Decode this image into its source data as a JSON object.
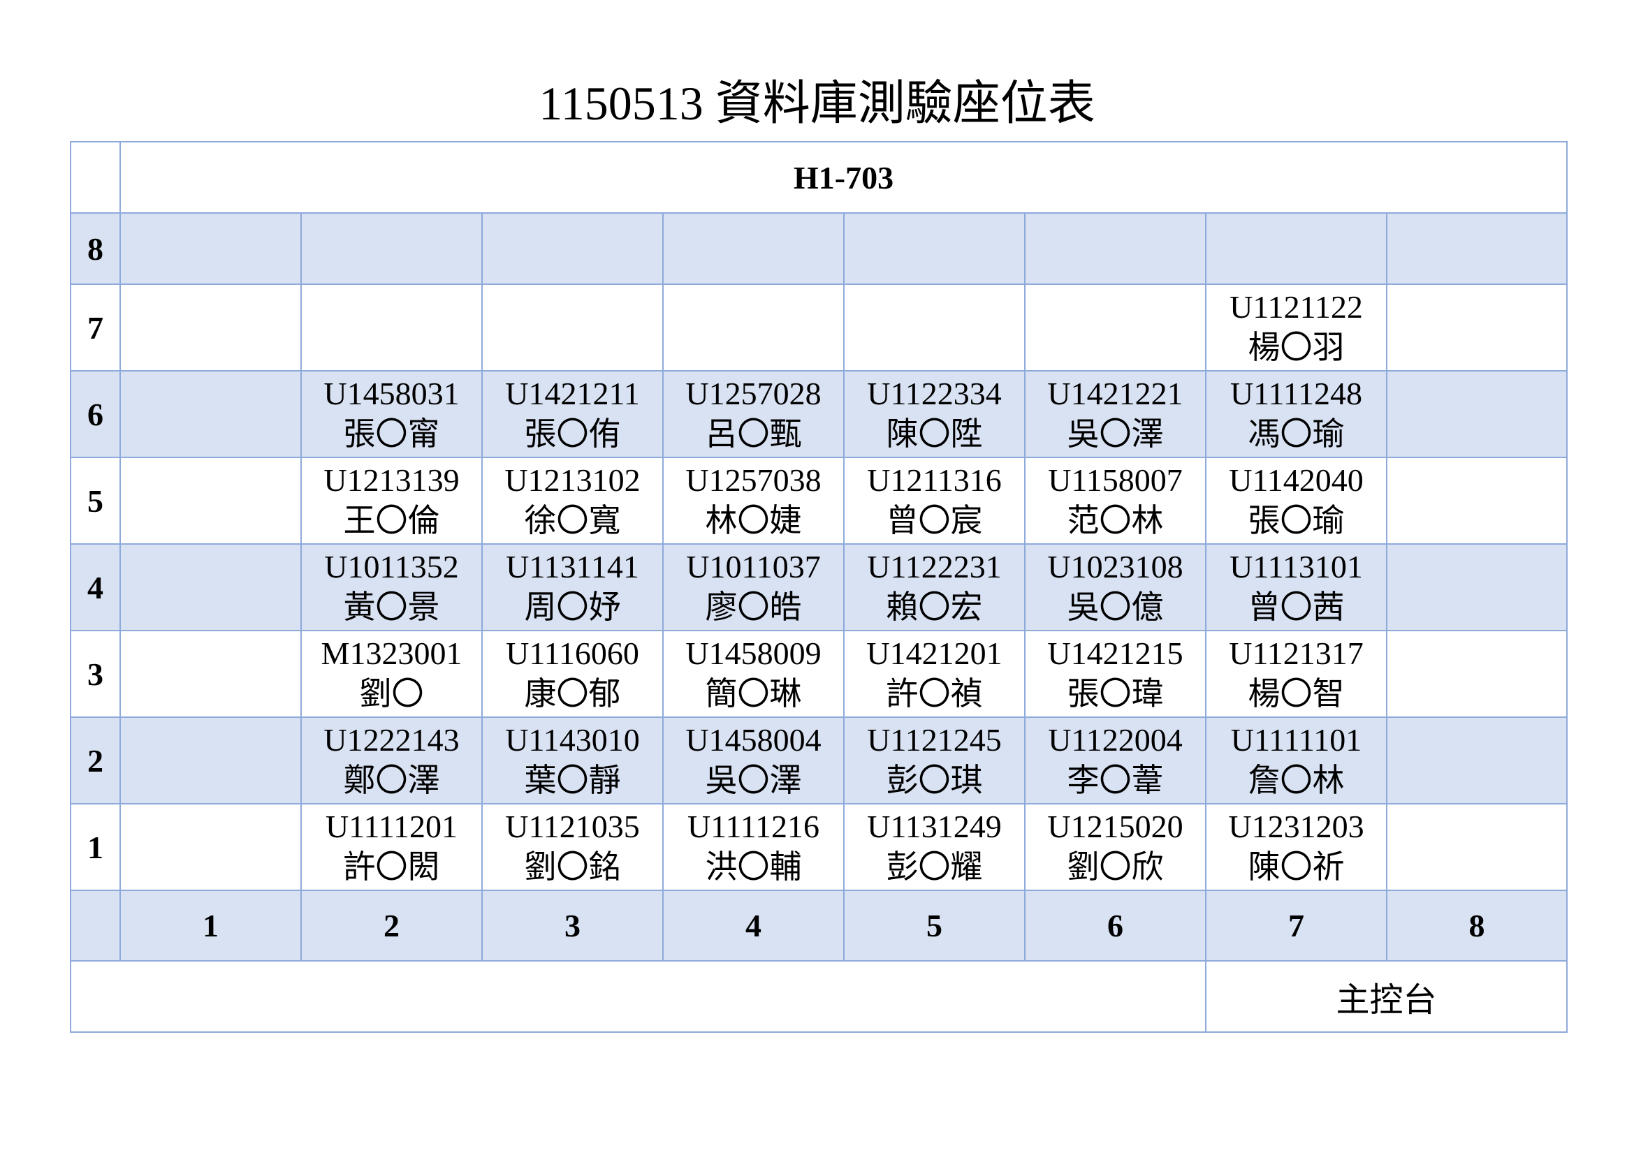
{
  "title": "1150513 資料庫測驗座位表",
  "room": "H1-703",
  "columns": [
    "1",
    "2",
    "3",
    "4",
    "5",
    "6",
    "7",
    "8"
  ],
  "rows": [
    {
      "num": "8",
      "shaded": true,
      "seats": [
        {
          "id": "",
          "name": ""
        },
        {
          "id": "",
          "name": ""
        },
        {
          "id": "",
          "name": ""
        },
        {
          "id": "",
          "name": ""
        },
        {
          "id": "",
          "name": ""
        },
        {
          "id": "",
          "name": ""
        },
        {
          "id": "",
          "name": ""
        },
        {
          "id": "",
          "name": ""
        }
      ]
    },
    {
      "num": "7",
      "shaded": false,
      "seats": [
        {
          "id": "",
          "name": ""
        },
        {
          "id": "",
          "name": ""
        },
        {
          "id": "",
          "name": ""
        },
        {
          "id": "",
          "name": ""
        },
        {
          "id": "",
          "name": ""
        },
        {
          "id": "",
          "name": ""
        },
        {
          "id": "U1121122",
          "name": "楊〇羽"
        },
        {
          "id": "",
          "name": ""
        }
      ]
    },
    {
      "num": "6",
      "shaded": true,
      "seats": [
        {
          "id": "",
          "name": ""
        },
        {
          "id": "U1458031",
          "name": "張〇甯"
        },
        {
          "id": "U1421211",
          "name": "張〇侑"
        },
        {
          "id": "U1257028",
          "name": "呂〇甄"
        },
        {
          "id": "U1122334",
          "name": "陳〇陞"
        },
        {
          "id": "U1421221",
          "name": "吳〇澤"
        },
        {
          "id": "U1111248",
          "name": "馮〇瑜"
        },
        {
          "id": "",
          "name": ""
        }
      ]
    },
    {
      "num": "5",
      "shaded": false,
      "seats": [
        {
          "id": "",
          "name": ""
        },
        {
          "id": "U1213139",
          "name": "王〇倫"
        },
        {
          "id": "U1213102",
          "name": "徐〇寬"
        },
        {
          "id": "U1257038",
          "name": "林〇婕"
        },
        {
          "id": "U1211316",
          "name": "曾〇宸"
        },
        {
          "id": "U1158007",
          "name": "范〇林"
        },
        {
          "id": "U1142040",
          "name": "張〇瑜"
        },
        {
          "id": "",
          "name": ""
        }
      ]
    },
    {
      "num": "4",
      "shaded": true,
      "seats": [
        {
          "id": "",
          "name": ""
        },
        {
          "id": "U1011352",
          "name": "黃〇景"
        },
        {
          "id": "U1131141",
          "name": "周〇妤"
        },
        {
          "id": "U1011037",
          "name": "廖〇皓"
        },
        {
          "id": "U1122231",
          "name": "賴〇宏"
        },
        {
          "id": "U1023108",
          "name": "吳〇億"
        },
        {
          "id": "U1113101",
          "name": "曾〇茜"
        },
        {
          "id": "",
          "name": ""
        }
      ]
    },
    {
      "num": "3",
      "shaded": false,
      "seats": [
        {
          "id": "",
          "name": ""
        },
        {
          "id": "M1323001",
          "name": "劉〇"
        },
        {
          "id": "U1116060",
          "name": "康〇郁"
        },
        {
          "id": "U1458009",
          "name": "簡〇琳"
        },
        {
          "id": "U1421201",
          "name": "許〇禎"
        },
        {
          "id": "U1421215",
          "name": "張〇瑋"
        },
        {
          "id": "U1121317",
          "name": "楊〇智"
        },
        {
          "id": "",
          "name": ""
        }
      ]
    },
    {
      "num": "2",
      "shaded": true,
      "seats": [
        {
          "id": "",
          "name": ""
        },
        {
          "id": "U1222143",
          "name": "鄭〇澤"
        },
        {
          "id": "U1143010",
          "name": "葉〇靜"
        },
        {
          "id": "U1458004",
          "name": "吳〇澤"
        },
        {
          "id": "U1121245",
          "name": "彭〇琪"
        },
        {
          "id": "U1122004",
          "name": "李〇葦"
        },
        {
          "id": "U1111101",
          "name": "詹〇林"
        },
        {
          "id": "",
          "name": ""
        }
      ]
    },
    {
      "num": "1",
      "shaded": false,
      "seats": [
        {
          "id": "",
          "name": ""
        },
        {
          "id": "U1111201",
          "name": "許〇閎"
        },
        {
          "id": "U1121035",
          "name": "劉〇銘"
        },
        {
          "id": "U1111216",
          "name": "洪〇輔"
        },
        {
          "id": "U1131249",
          "name": "彭〇耀"
        },
        {
          "id": "U1215020",
          "name": "劉〇欣"
        },
        {
          "id": "U1231203",
          "name": "陳〇祈"
        },
        {
          "id": "",
          "name": ""
        }
      ]
    }
  ],
  "console_label": "主控台",
  "colors": {
    "border": "#8eaadb",
    "shaded_fill": "#d9e2f3"
  }
}
